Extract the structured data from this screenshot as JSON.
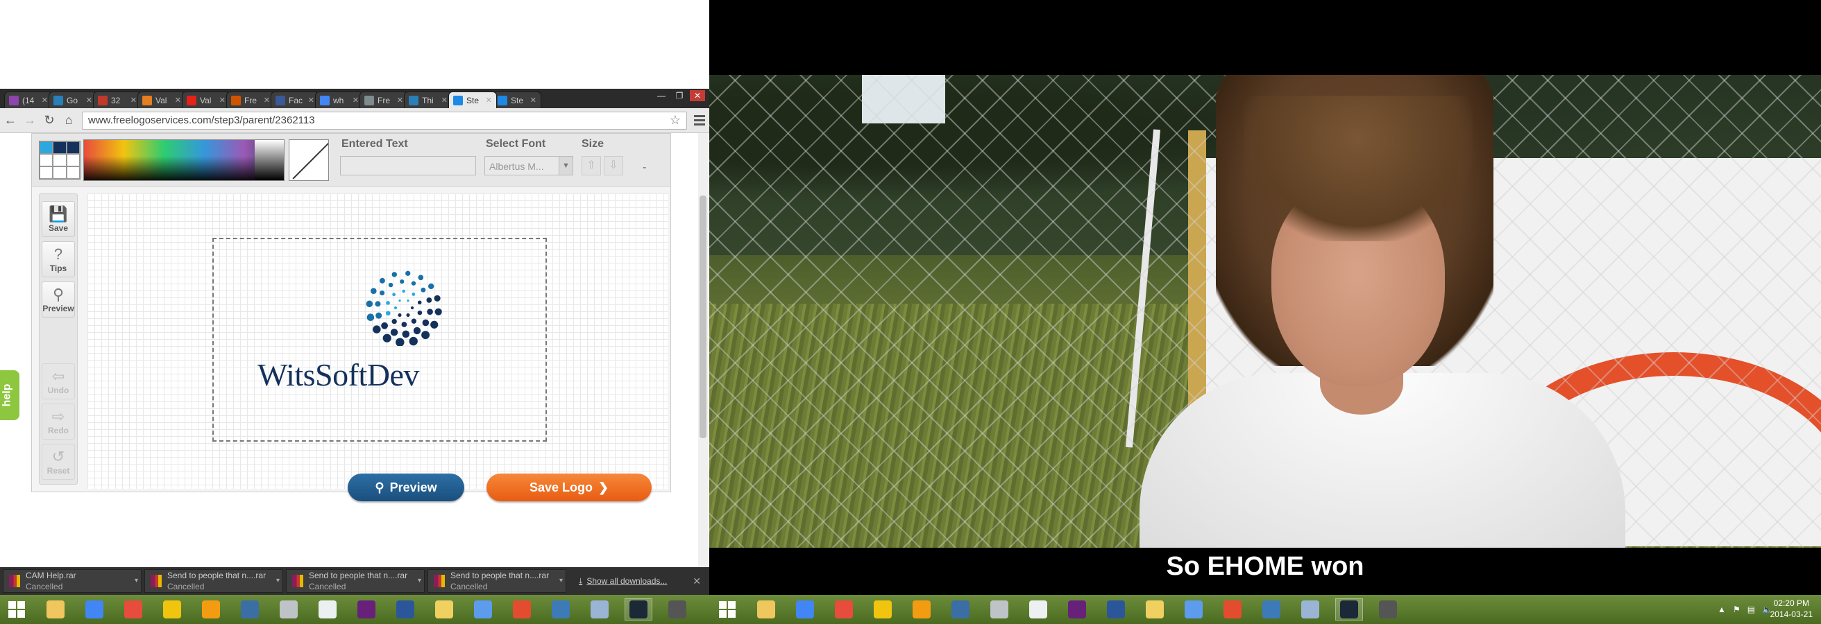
{
  "browser": {
    "tabs": [
      {
        "title": "(14",
        "color": "#8e44ad"
      },
      {
        "title": "Go",
        "color": "#2980b9"
      },
      {
        "title": "32",
        "color": "#c0392b"
      },
      {
        "title": "Val",
        "color": "#e67e22"
      },
      {
        "title": "Val",
        "color": "#e62117"
      },
      {
        "title": "Fre",
        "color": "#d35400"
      },
      {
        "title": "Fac",
        "color": "#3b5998"
      },
      {
        "title": "wh",
        "color": "#4285f4"
      },
      {
        "title": "Fre",
        "color": "#7f8c8d"
      },
      {
        "title": "Thi",
        "color": "#2980b9"
      },
      {
        "title": "Ste",
        "color": "#1e88e5",
        "active": true
      },
      {
        "title": "Ste",
        "color": "#1e88e5"
      }
    ],
    "url": "www.freelogoservices.com/step3/parent/2362113"
  },
  "editor": {
    "entered_text_label": "Entered Text",
    "entered_text_value": "",
    "select_font_label": "Select Font",
    "font_value": "Albertus M...",
    "size_label": "Size",
    "size_value": "-",
    "tools": {
      "save": "Save",
      "tips": "Tips",
      "preview": "Preview",
      "undo": "Undo",
      "redo": "Redo",
      "reset": "Reset"
    },
    "logo_text": "WitsSoftDev",
    "logo_colors": [
      "#29a9e0",
      "#1a6fa8",
      "#14315c"
    ],
    "preview_button": "Preview",
    "save_logo_button": "Save Logo",
    "help_tab": "help"
  },
  "downloads": {
    "items": [
      {
        "name": "CAM Help.rar",
        "status": "Cancelled"
      },
      {
        "name": "Send to people that n....rar",
        "status": "Cancelled"
      },
      {
        "name": "Send to people that n....rar",
        "status": "Cancelled"
      },
      {
        "name": "Send to people that n....rar",
        "status": "Cancelled"
      }
    ],
    "show_all": "Show all downloads..."
  },
  "video": {
    "subtitle": "So EHOME won"
  },
  "taskbar": {
    "time": "02:20 PM",
    "date": "2014-03-21",
    "icons_left": [
      "windows-start",
      "file-explorer",
      "chrome",
      "media-player",
      "sticky-app",
      "vlc",
      "xbmc",
      "tool",
      "notepad",
      "visual-studio",
      "word",
      "folder",
      "network",
      "git",
      "remote-desktop",
      "virtualbox",
      "steam",
      "media-center"
    ],
    "icons_right": [
      "windows-start",
      "file-explorer",
      "chrome",
      "media-player",
      "sticky-app",
      "vlc",
      "xbmc",
      "tool",
      "notepad",
      "visual-studio",
      "word",
      "folder",
      "network",
      "git",
      "remote-desktop",
      "virtualbox",
      "steam",
      "media-center"
    ]
  }
}
